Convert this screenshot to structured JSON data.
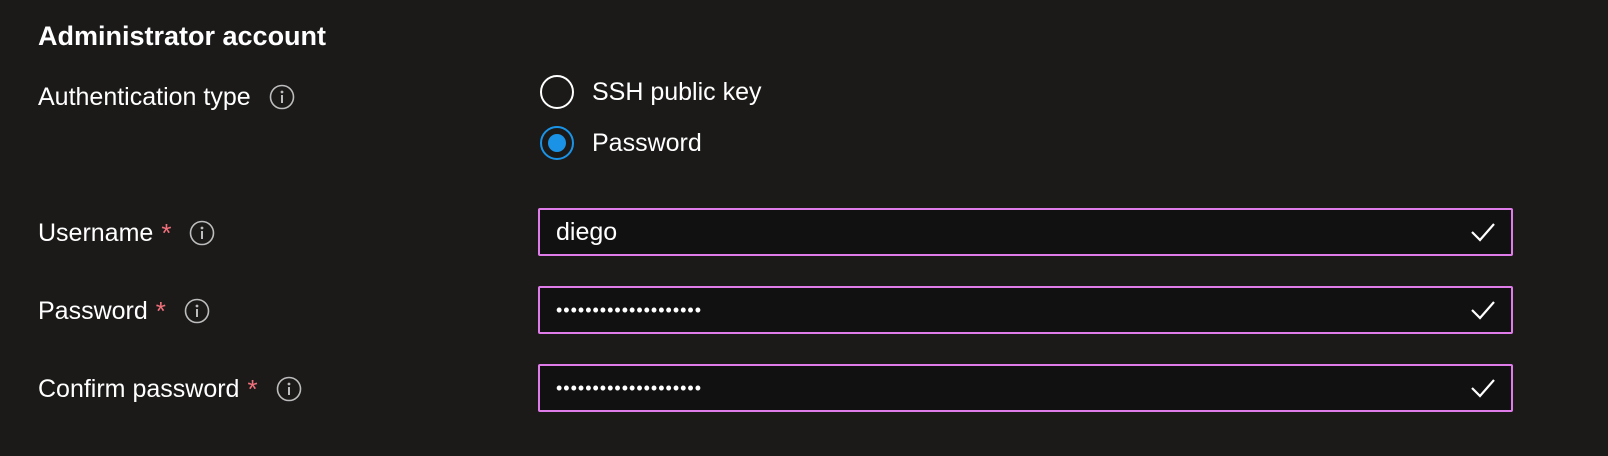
{
  "section": {
    "title": "Administrator account"
  },
  "auth_type": {
    "label": "Authentication type",
    "options": [
      {
        "label": "SSH public key",
        "selected": false
      },
      {
        "label": "Password",
        "selected": true
      }
    ]
  },
  "username": {
    "label": "Username",
    "required_marker": "*",
    "value": "diego"
  },
  "password": {
    "label": "Password",
    "required_marker": "*",
    "value": "••••••••••••••••••••"
  },
  "confirm_password": {
    "label": "Confirm password",
    "required_marker": "*",
    "value": "••••••••••••••••••••"
  },
  "colors": {
    "background": "#1b1a19",
    "accent_blue": "#1a93e6",
    "field_border": "#e07cea",
    "required_red": "#f1707b"
  },
  "icons": {
    "info": "info-icon",
    "valid": "checkmark-icon"
  }
}
